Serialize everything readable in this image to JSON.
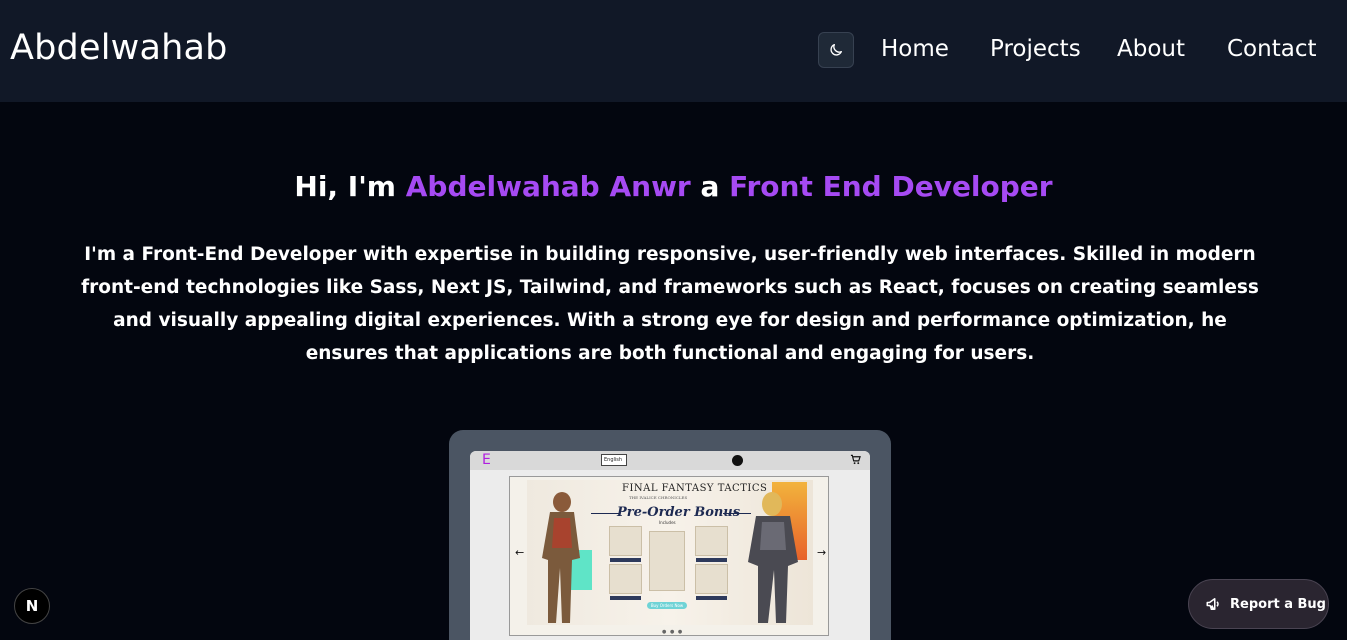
{
  "navbar": {
    "brand": "Abdelwahab",
    "theme_toggle_icon": "moon-icon",
    "links": [
      "Home",
      "Projects",
      "About",
      "Contact"
    ]
  },
  "hero": {
    "greeting": "Hi, I'm",
    "name": "Abdelwahab Anwr",
    "connector": "a",
    "role": "Front End Developer",
    "description": "I'm a Front-End Developer with expertise in building responsive, user-friendly web interfaces. Skilled in modern front-end technologies like Sass, Next JS, Tailwind, and frameworks such as React, focuses on creating seamless and visually appealing digital experiences. With a strong eye for design and performance optimization, he ensures that applications are both functional and engaging for users."
  },
  "project_preview": {
    "logo": "E",
    "language": "English",
    "banner_title": "FINAL FANTASY TACTICS",
    "banner_subtitle": "THE IVALICE CHRONICLES",
    "bonus_title": "Pre-Order Bonus",
    "includes": "Includes",
    "button_label": "Buy Orders Now"
  },
  "colors": {
    "accent": "#a64af3",
    "navbar_bg": "#111827",
    "page_bg": "#03060f"
  },
  "badge": {
    "label": "N"
  },
  "report_bug": {
    "label": "Report a Bug",
    "icon": "megaphone-icon"
  }
}
